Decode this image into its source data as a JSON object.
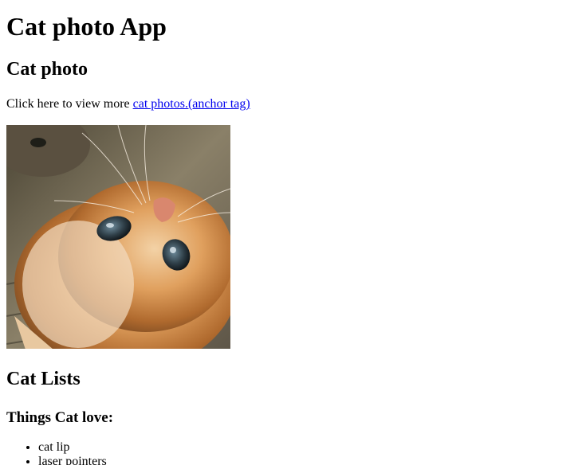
{
  "page": {
    "title": "Cat photo App",
    "section_photo": {
      "heading": "Cat photo",
      "intro_text": "Click here to view more ",
      "link_text": "cat photos.(anchor tag)"
    },
    "section_lists": {
      "heading": "Cat Lists",
      "subheading": "Things Cat love:",
      "items": [
        "cat lip",
        "laser pointers"
      ]
    }
  },
  "colors": {
    "link": "#0000ee",
    "text": "#000000",
    "background": "#ffffff"
  }
}
